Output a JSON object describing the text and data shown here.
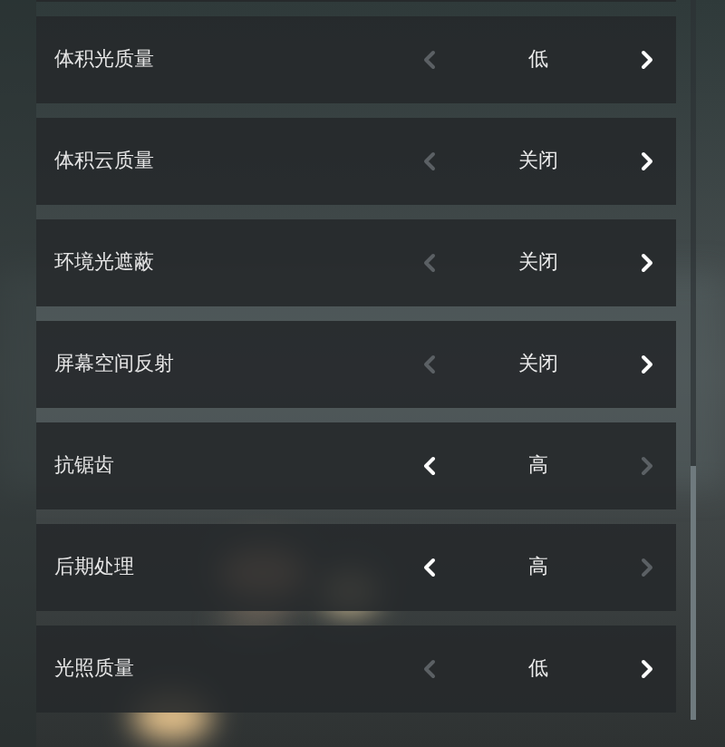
{
  "settings": [
    {
      "label": "体积光质量",
      "value": "低",
      "prev_enabled": false,
      "next_enabled": true
    },
    {
      "label": "体积云质量",
      "value": "关闭",
      "prev_enabled": false,
      "next_enabled": true
    },
    {
      "label": "环境光遮蔽",
      "value": "关闭",
      "prev_enabled": false,
      "next_enabled": true
    },
    {
      "label": "屏幕空间反射",
      "value": "关闭",
      "prev_enabled": false,
      "next_enabled": true
    },
    {
      "label": "抗锯齿",
      "value": "高",
      "prev_enabled": true,
      "next_enabled": false
    },
    {
      "label": "后期处理",
      "value": "高",
      "prev_enabled": true,
      "next_enabled": false
    },
    {
      "label": "光照质量",
      "value": "低",
      "prev_enabled": false,
      "next_enabled": true
    }
  ]
}
